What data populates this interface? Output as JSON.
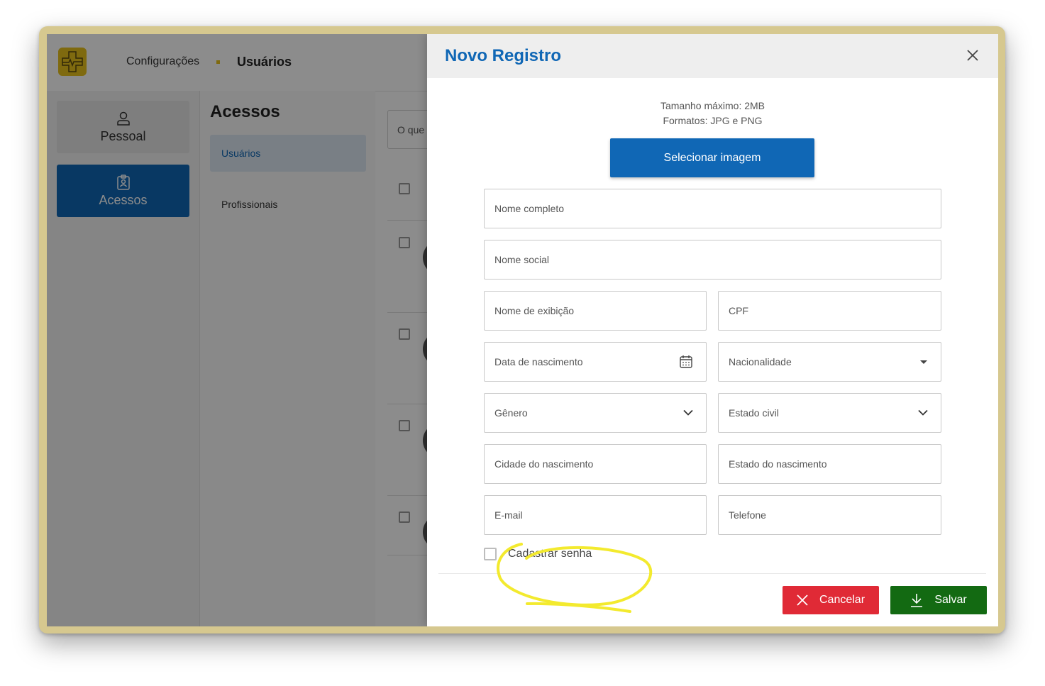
{
  "header": {
    "breadcrumb_parent": "Configurações",
    "breadcrumb_current": "Usuários"
  },
  "sidebar": {
    "items": [
      {
        "label": "Pessoal",
        "icon": "user-icon"
      },
      {
        "label": "Acessos",
        "icon": "badge-icon",
        "active": true
      }
    ]
  },
  "subnav": {
    "title": "Acessos",
    "items": [
      {
        "label": "Usuários",
        "active": true
      },
      {
        "label": "Profissionais"
      }
    ]
  },
  "list": {
    "search_placeholder": "O que"
  },
  "modal": {
    "title": "Novo Registro",
    "upload": {
      "max_size": "Tamanho máximo: 2MB",
      "formats": "Formatos: JPG e PNG",
      "button": "Selecionar imagem"
    },
    "fields": {
      "full_name": "Nome completo",
      "social_name": "Nome social",
      "display_name": "Nome de exibição",
      "cpf": "CPF",
      "birth_date": "Data de nascimento",
      "nationality": "Nacionalidade",
      "gender": "Gênero",
      "marital_status": "Estado civil",
      "birth_city": "Cidade do nascimento",
      "birth_state": "Estado do nascimento",
      "email": "E-mail",
      "phone": "Telefone"
    },
    "register_password": "Cadastrar senha",
    "cancel": "Cancelar",
    "save": "Salvar"
  },
  "colors": {
    "primary": "#1067b5",
    "brand_yellow": "#e8c21c",
    "cancel": "#e02a36",
    "save": "#136a12",
    "annotation": "#f3ea2e"
  }
}
